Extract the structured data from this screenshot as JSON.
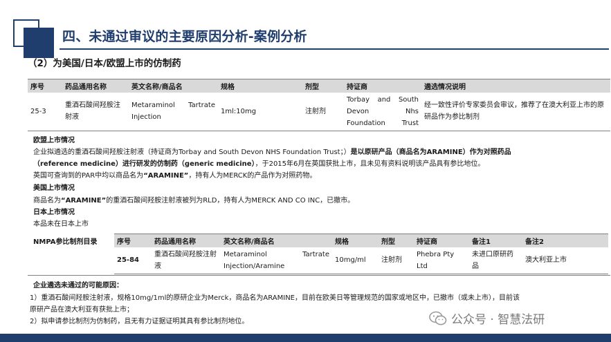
{
  "header": {
    "title": "四、未通过审议的主要原因分析-案例分析"
  },
  "section": {
    "title": "（2）为美国/日本/欧盟上市的仿制药"
  },
  "table1": {
    "headers": [
      "序号",
      "药品通用名称",
      "英文名称/商品名",
      "规格",
      "剂型",
      "持证商",
      "遴选情况说明"
    ],
    "row": {
      "no": "25-3",
      "cn_name": "重酒石酸间羟胺注射液",
      "en_name": "Metaraminol Tartrate Injection",
      "spec": "1ml:10mg",
      "form": "注射剂",
      "holder": "Torbay and South Devon Nhs Foundation Trust",
      "note": "经一致性评价专家委员会审议，推荐了在澳大利亚上市的原研品作为参比制剂"
    }
  },
  "info": {
    "eu_heading": "欧盟上市情况",
    "eu_line1_a": "企业拟遴选的重酒石酸间羟胺注射液（持证商为Torbay and South Devon NHS Foundation Trust；）",
    "eu_line1_b": "是以原研产品（商品名为ARAMINE）作为对照药品",
    "eu_line2_a": "（reference medicine）进行研发的仿制药（generic medicine）",
    "eu_line2_b": "，于2015年6月在英国获批上市，且未见有资料说明该产品具有参比地位。",
    "eu_line3_a": "英国可查询到的PAR中均以商品名为",
    "eu_line3_b": "“ARAMINE”",
    "eu_line3_c": "，持有人为MERCK的产品作为对照药物。",
    "us_heading": "美国上市情况",
    "us_line_a": "商品名为",
    "us_line_b": "“ARAMINE”",
    "us_line_c": "的重酒石酸间羟胺注射液被列为RLD，持有人为MERCK AND CO INC，已撤市。",
    "jp_heading": "日本上市情况",
    "jp_line": "本品未在日本上市"
  },
  "nmpa": {
    "label": "NMPA参比制剂目录",
    "headers": [
      "序号",
      "药品通用名称",
      "英文名称/商品名",
      "规格",
      "剂型",
      "持证商",
      "备注1",
      "备注2"
    ],
    "row": {
      "no": "25-84",
      "cn_name": "重酒石酸间羟胺注射液",
      "en_name": "Metaraminol Tartrate Injection/Aramine",
      "spec": "10mg/ml",
      "form": "注射剂",
      "holder": "Phebra Pty Ltd",
      "note1": "未进口原研药品",
      "note2": "澳大利亚上市"
    }
  },
  "reasons": {
    "heading": "企业遴选未通过的可能原因：",
    "line1": "1）重酒石酸间羟胺注射液，规格10mg/1ml的原研企业为Merck，商品名为ARAMINE，目前在欧美日等管理规范的国家或地区中，已撤市（或未上市），目前该",
    "line2": "原研产品在澳大利亚有获批上市；",
    "line3": "2）拟申请参比制剂为仿制药，且无有力证据证明其具有参比制剂地位。"
  },
  "watermark": {
    "text": "公众号 · 智慧法研",
    "icon": "wechat-icon"
  },
  "colors": {
    "brand": "#1f3d6d",
    "header_bg": "#d9d9d9"
  }
}
